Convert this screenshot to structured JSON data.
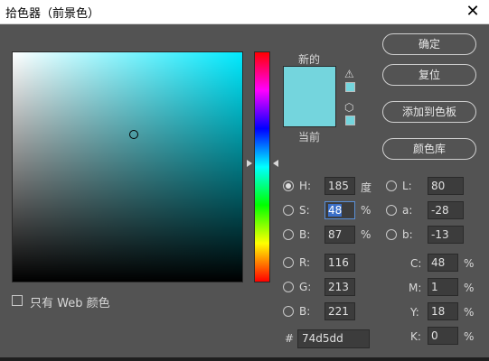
{
  "window": {
    "title": "拾色器（前景色）",
    "close_glyph": "✕"
  },
  "swatch": {
    "new_label": "新的",
    "current_label": "当前",
    "new_color": "#74d5dd",
    "current_color": "#74d5dd"
  },
  "icons": {
    "warning": "⚠",
    "cube": "⬡"
  },
  "buttons": {
    "ok": "确定",
    "reset": "复位",
    "add_swatch": "添加到色板",
    "libraries": "颜色库"
  },
  "hsb": {
    "h": {
      "label": "H:",
      "value": "185",
      "unit": "度"
    },
    "s": {
      "label": "S:",
      "value": "48",
      "unit": "%"
    },
    "b": {
      "label": "B:",
      "value": "87",
      "unit": "%"
    }
  },
  "lab": {
    "l": {
      "label": "L:",
      "value": "80"
    },
    "a": {
      "label": "a:",
      "value": "-28"
    },
    "b": {
      "label": "b:",
      "value": "-13"
    }
  },
  "rgb": {
    "r": {
      "label": "R:",
      "value": "116"
    },
    "g": {
      "label": "G:",
      "value": "213"
    },
    "b": {
      "label": "B:",
      "value": "221"
    }
  },
  "cmyk": {
    "c": {
      "label": "C:",
      "value": "48",
      "unit": "%"
    },
    "m": {
      "label": "M:",
      "value": "1",
      "unit": "%"
    },
    "y": {
      "label": "Y:",
      "value": "18",
      "unit": "%"
    },
    "k": {
      "label": "K:",
      "value": "0",
      "unit": "%"
    }
  },
  "hex": {
    "symbol": "#",
    "value": "74d5dd"
  },
  "web_only": {
    "label": "只有 Web 颜色",
    "checked": false
  },
  "selected_mode": "H"
}
